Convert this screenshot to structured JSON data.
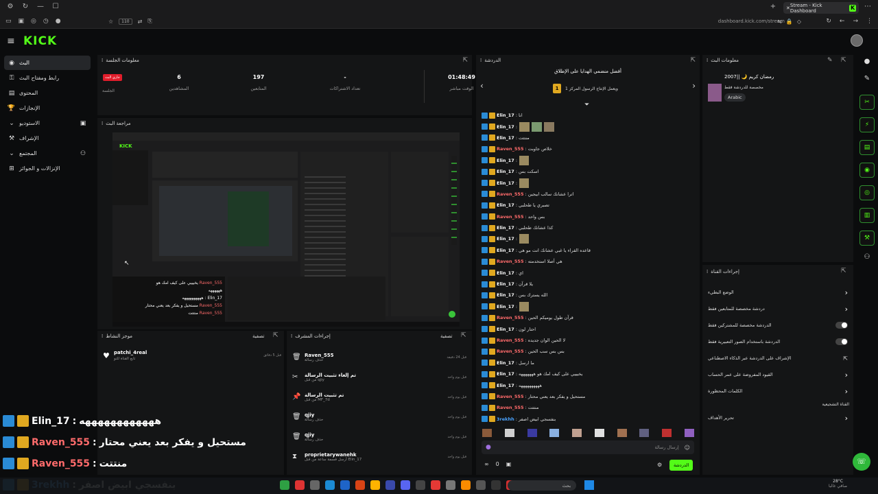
{
  "browser": {
    "tab_title": "Stream - Kick Dashboard",
    "url": "dashboard.kick.com/stream",
    "zoom": "110"
  },
  "kick": {
    "logo": "KICK"
  },
  "sidebar": {
    "items": [
      {
        "label": "البث",
        "icon": "live-icon",
        "active": true
      },
      {
        "label": "رابط ومفتاح البث",
        "icon": "key-icon"
      },
      {
        "label": "المحتوى",
        "icon": "content-icon"
      },
      {
        "label": "الإنجازات",
        "icon": "trophy-icon"
      },
      {
        "label": "الاستوديو",
        "icon": "studio-icon"
      },
      {
        "label": "الإشراف",
        "icon": "hammer-icon"
      },
      {
        "label": "المجتمع",
        "icon": "community-icon"
      },
      {
        "label": "الإنزالات و الجوائز",
        "icon": "gift-icon"
      }
    ]
  },
  "session": {
    "title": "معلومات الجلسة",
    "live_badge": "جاري البث",
    "live_label": "الجلسة",
    "stats": [
      {
        "value": "6",
        "label": "المشاهدين"
      },
      {
        "value": "197",
        "label": "المتابعين"
      },
      {
        "value": "-",
        "label": "تعداد الاشتراكات"
      },
      {
        "value": "01:48:49",
        "label": "الوقت مباشر"
      }
    ]
  },
  "preview": {
    "title": "مراجعة البث"
  },
  "followers": {
    "title": "موجز النشاط",
    "filter": "تصفية",
    "items": [
      {
        "name": "patchi_4real",
        "sub": "تابع القناة للتو",
        "time": "قبل 5 دقائق"
      }
    ]
  },
  "modactions": {
    "title": "إجراءات المشرف",
    "filter": "تصفية",
    "items": [
      {
        "icon": "trash-icon",
        "name": "Raven_555",
        "sub": "حذف رسالة",
        "time": "قبل 24 دقيقة"
      },
      {
        "icon": "unpin-icon",
        "name": "تم إلغاء تثبيت الرسالة",
        "sub": "من قبل qjiy",
        "time": "قبل يوم واحد"
      },
      {
        "icon": "pin-icon",
        "name": "تم تثبيت الرسالة",
        "sub": "من قبل MF_7d",
        "time": "قبل يوم واحد"
      },
      {
        "icon": "trash-icon",
        "name": "qjiy",
        "sub": "حذف رسالة",
        "time": "قبل يوم واحد"
      },
      {
        "icon": "trash-icon",
        "name": "qjiy",
        "sub": "حذف رسالة",
        "time": "قبل يوم واحد"
      },
      {
        "icon": "timer-icon",
        "name": "proprietarywanehk",
        "sub": "أرسل قسمة ساعة من قبل Elin_17",
        "time": "قبل يوم واحد"
      }
    ]
  },
  "chat": {
    "title": "الدردشة",
    "pinned_title": "أفضل منضمي الهدايا على الإطلاق",
    "pinned_sub": "ويعمل الإنتاج الرسول المركز 1",
    "messages": [
      {
        "user": "Elin_17",
        "color": "#ffffff",
        "text": "انا"
      },
      {
        "user": "Elin_17",
        "color": "#ffffff",
        "text": "",
        "thumbs": 3
      },
      {
        "user": "Elin_17",
        "color": "#ffffff",
        "text": "منتتت"
      },
      {
        "user": "Raven_555",
        "color": "#ff6b6b",
        "text": "خلاص جاوبت"
      },
      {
        "user": "Elin_17",
        "color": "#ffffff",
        "text": "",
        "thumbs": 1
      },
      {
        "user": "Elin_17",
        "color": "#ffffff",
        "text": "اسكت بس"
      },
      {
        "user": "Elin_17",
        "color": "#ffffff",
        "text": "",
        "thumbs": 1
      },
      {
        "user": "Raven_555",
        "color": "#ff6b6b",
        "text": "اترا عشانك سالب ابيجين"
      },
      {
        "user": "Elin_17",
        "color": "#ffffff",
        "text": "تصبري يا طحلبي"
      },
      {
        "user": "Raven_555",
        "color": "#ff6b6b",
        "text": "بس واحد"
      },
      {
        "user": "Elin_17",
        "color": "#ffffff",
        "text": "كذا عشانك طحلبي"
      },
      {
        "user": "Elin_17",
        "color": "#ffffff",
        "text": "",
        "thumbs": 1
      },
      {
        "user": "Elin_17",
        "color": "#ffffff",
        "text": "قاعده القراء يا غبي عشانك انت مو هي"
      },
      {
        "user": "Raven_555",
        "color": "#ff6b6b",
        "text": "هي أصلا استخدمته"
      },
      {
        "user": "Elin_17",
        "color": "#ffffff",
        "text": "اي"
      },
      {
        "user": "Elin_17",
        "color": "#ffffff",
        "text": "يلا قرآن"
      },
      {
        "user": "Elin_17",
        "color": "#ffffff",
        "text": "الله يسترك بس"
      },
      {
        "user": "Elin_17",
        "color": "#ffffff",
        "text": "",
        "thumbs": 1
      },
      {
        "user": "Raven_555",
        "color": "#ff6b6b",
        "text": "قرآن طول يوميكم الحين"
      },
      {
        "user": "Elin_17",
        "color": "#ffffff",
        "text": "احتار لون"
      },
      {
        "user": "Raven_555",
        "color": "#ff6b6b",
        "text": "لا الحين الوان جديده"
      },
      {
        "user": "Raven_555",
        "color": "#ff6b6b",
        "text": "بس بس سب الحين"
      },
      {
        "user": "Elin_17",
        "color": "#ffffff",
        "text": "ما ارسل"
      },
      {
        "user": "Elin_17",
        "color": "#ffffff",
        "text": "يخيييي على كيف امك هو هههههههه"
      },
      {
        "user": "Elin_17",
        "color": "#ffffff",
        "text": "ههههههههههه"
      },
      {
        "user": "Raven_555",
        "color": "#ff6b6b",
        "text": "مستحيل و يفكر بعد يعني محتار"
      },
      {
        "user": "Raven_555",
        "color": "#ff6b6b",
        "text": "منتتت"
      },
      {
        "user": "3rekhh",
        "color": "#4aa3ff",
        "text": "بنفسجي ابيض اصفر"
      }
    ],
    "input_placeholder": "إرسال رسالة",
    "send_label": "الدردشة",
    "count": "0"
  },
  "streaminfo": {
    "title": "معلومات البث",
    "stream_title": "رمضان كريم 🌙 ||2007",
    "stream_sub": "مخصصة للدردشة فقط",
    "language": "Arabic"
  },
  "chatactions": {
    "title": "إجراءات القناة",
    "rows": [
      {
        "label": "الوضع البطيء",
        "kind": "chevron"
      },
      {
        "label": "دردشة مخصصة للمتابعين فقط",
        "kind": "chevron"
      },
      {
        "label": "الدردشة مخصصة للمشتركين فقط",
        "kind": "toggle"
      },
      {
        "label": "الدردشة باستخدام الصور التعبيرية فقط",
        "kind": "toggle"
      },
      {
        "label": "الإشراف على الدردشة عبر الذكاء الاصطناعي",
        "kind": "link"
      },
      {
        "label": "القيود المفروضة على عمر الحساب",
        "kind": "chevron"
      },
      {
        "label": "الكلمات المحظورة",
        "kind": "chevron"
      }
    ],
    "section": "القناة التشجيعية",
    "goals": "تحرير الأهداف"
  },
  "overlay": [
    {
      "user": "Elin_17",
      "color": "#ffffff",
      "text": "ههههههههههههه"
    },
    {
      "user": "Raven_555",
      "color": "#ff6b6b",
      "text": "مستحيل و يفكر بعد يعني محتار"
    },
    {
      "user": "Raven_555",
      "color": "#ff6b6b",
      "text": "منتتت"
    },
    {
      "user": "3rekhh",
      "color": "#4aa3ff",
      "text": "بنفسجي ابيض اصفر"
    }
  ],
  "taskbar": {
    "search": "بحث",
    "weather": "28°C",
    "weather_sub": "صافي غالبا"
  },
  "colors": {
    "accent": "#53fc18",
    "panel": "#141516",
    "bg": "#0b0c0d"
  }
}
